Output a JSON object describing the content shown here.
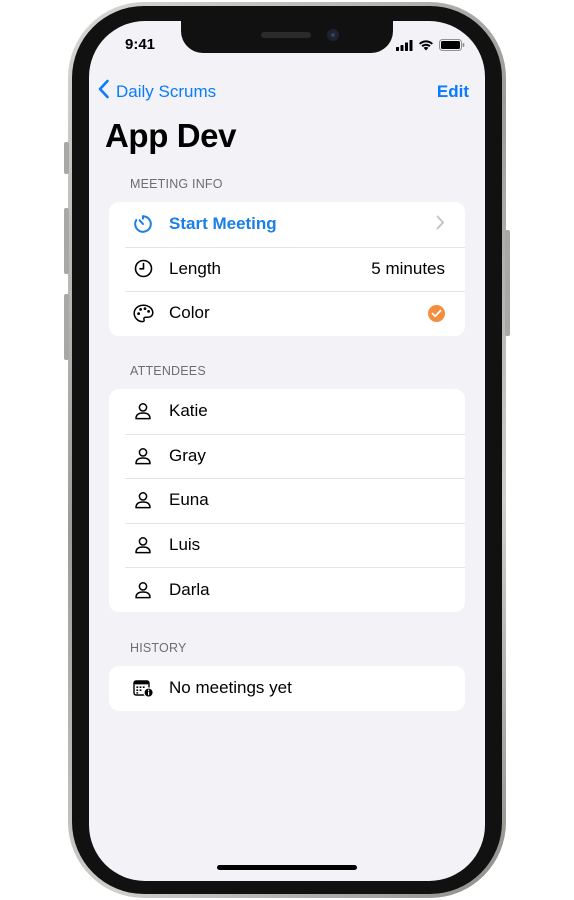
{
  "status_bar": {
    "time": "9:41"
  },
  "nav": {
    "back_label": "Daily Scrums",
    "edit_label": "Edit"
  },
  "title": "App Dev",
  "meeting_info": {
    "header": "MEETING INFO",
    "start_label": "Start Meeting",
    "length_label": "Length",
    "length_value": "5 minutes",
    "color_label": "Color",
    "color_value": "#f48d3e"
  },
  "attendees": {
    "header": "ATTENDEES",
    "items": [
      {
        "name": "Katie"
      },
      {
        "name": "Gray"
      },
      {
        "name": "Euna"
      },
      {
        "name": "Luis"
      },
      {
        "name": "Darla"
      }
    ]
  },
  "history": {
    "header": "HISTORY",
    "empty_label": "No meetings yet"
  },
  "colors": {
    "accent": "#0a7aff",
    "background": "#f2f2f7",
    "theme": "#f48d3e"
  }
}
